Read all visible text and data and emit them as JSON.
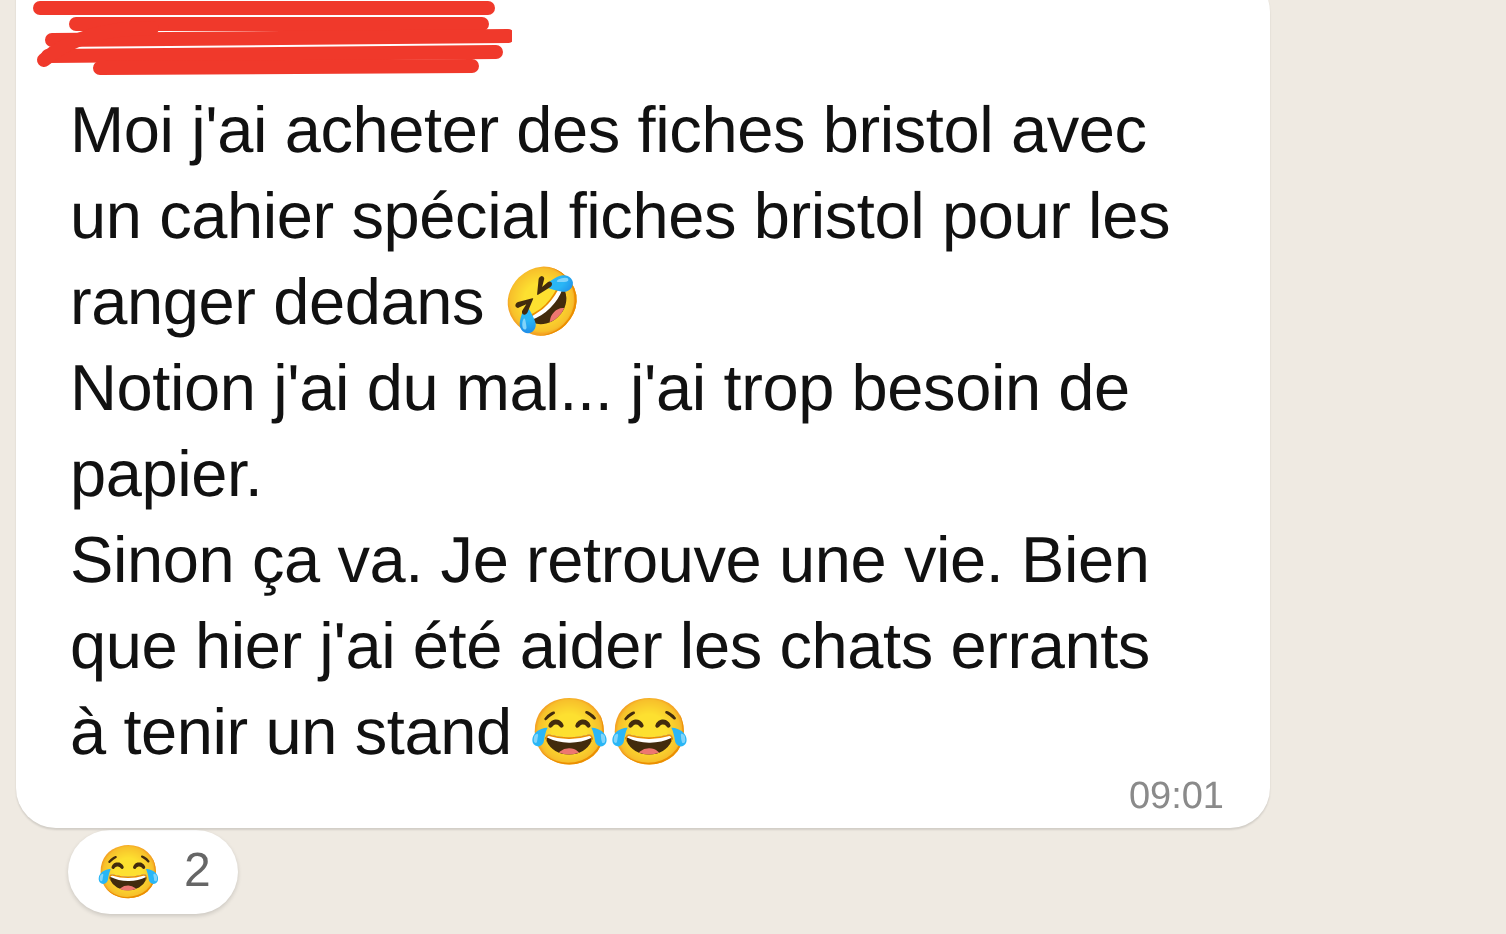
{
  "message": {
    "paragraphs": [
      "Moi j'ai acheter des fiches bristol avec un cahier spécial fiches bristol pour les ranger dedans 🤣",
      "Notion j'ai du mal... j'ai trop besoin de papier.",
      "Sinon ça va. Je retrouve une vie. Bien que hier j'ai été aider les chats errants à tenir un stand 😂😂"
    ],
    "time": "09:01",
    "reactions": [
      {
        "emoji": "😂",
        "count": "2"
      }
    ]
  }
}
